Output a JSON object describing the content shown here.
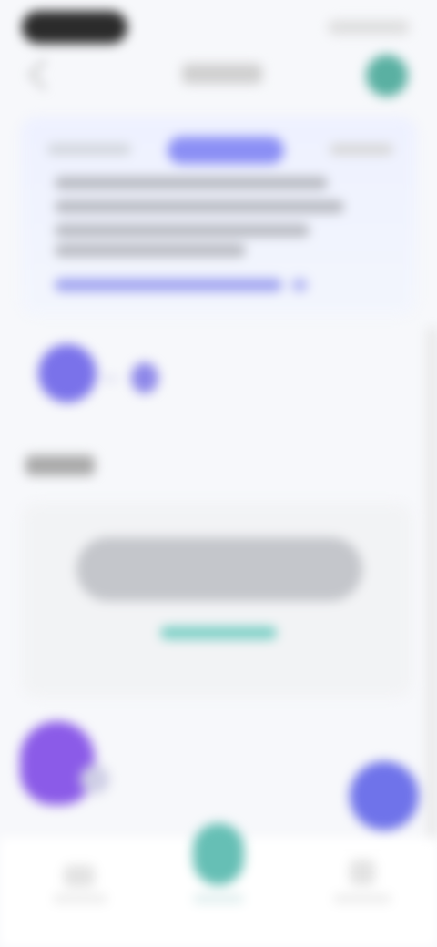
{
  "ui": {
    "note": "",
    "header": {
      "title": ""
    },
    "hero_card": {
      "left_label": "",
      "badge": "",
      "right_label": "",
      "body": "",
      "link": ""
    },
    "section": {
      "title": ""
    },
    "empty_state": {
      "message": "",
      "action": ""
    },
    "tabbar": {
      "left_label": "",
      "center_label": "",
      "right_label": ""
    }
  },
  "colors": {
    "accent": "#8b8ff5",
    "teal": "#66bfb5",
    "purple": "#7a72ea",
    "background": "#f7f8fb"
  },
  "icons": {
    "back": "chevron-left-icon",
    "profile": "avatar-icon",
    "fab": "plus-icon",
    "tab_left": "home-icon",
    "tab_center": "center-icon",
    "tab_right": "profile-icon"
  }
}
